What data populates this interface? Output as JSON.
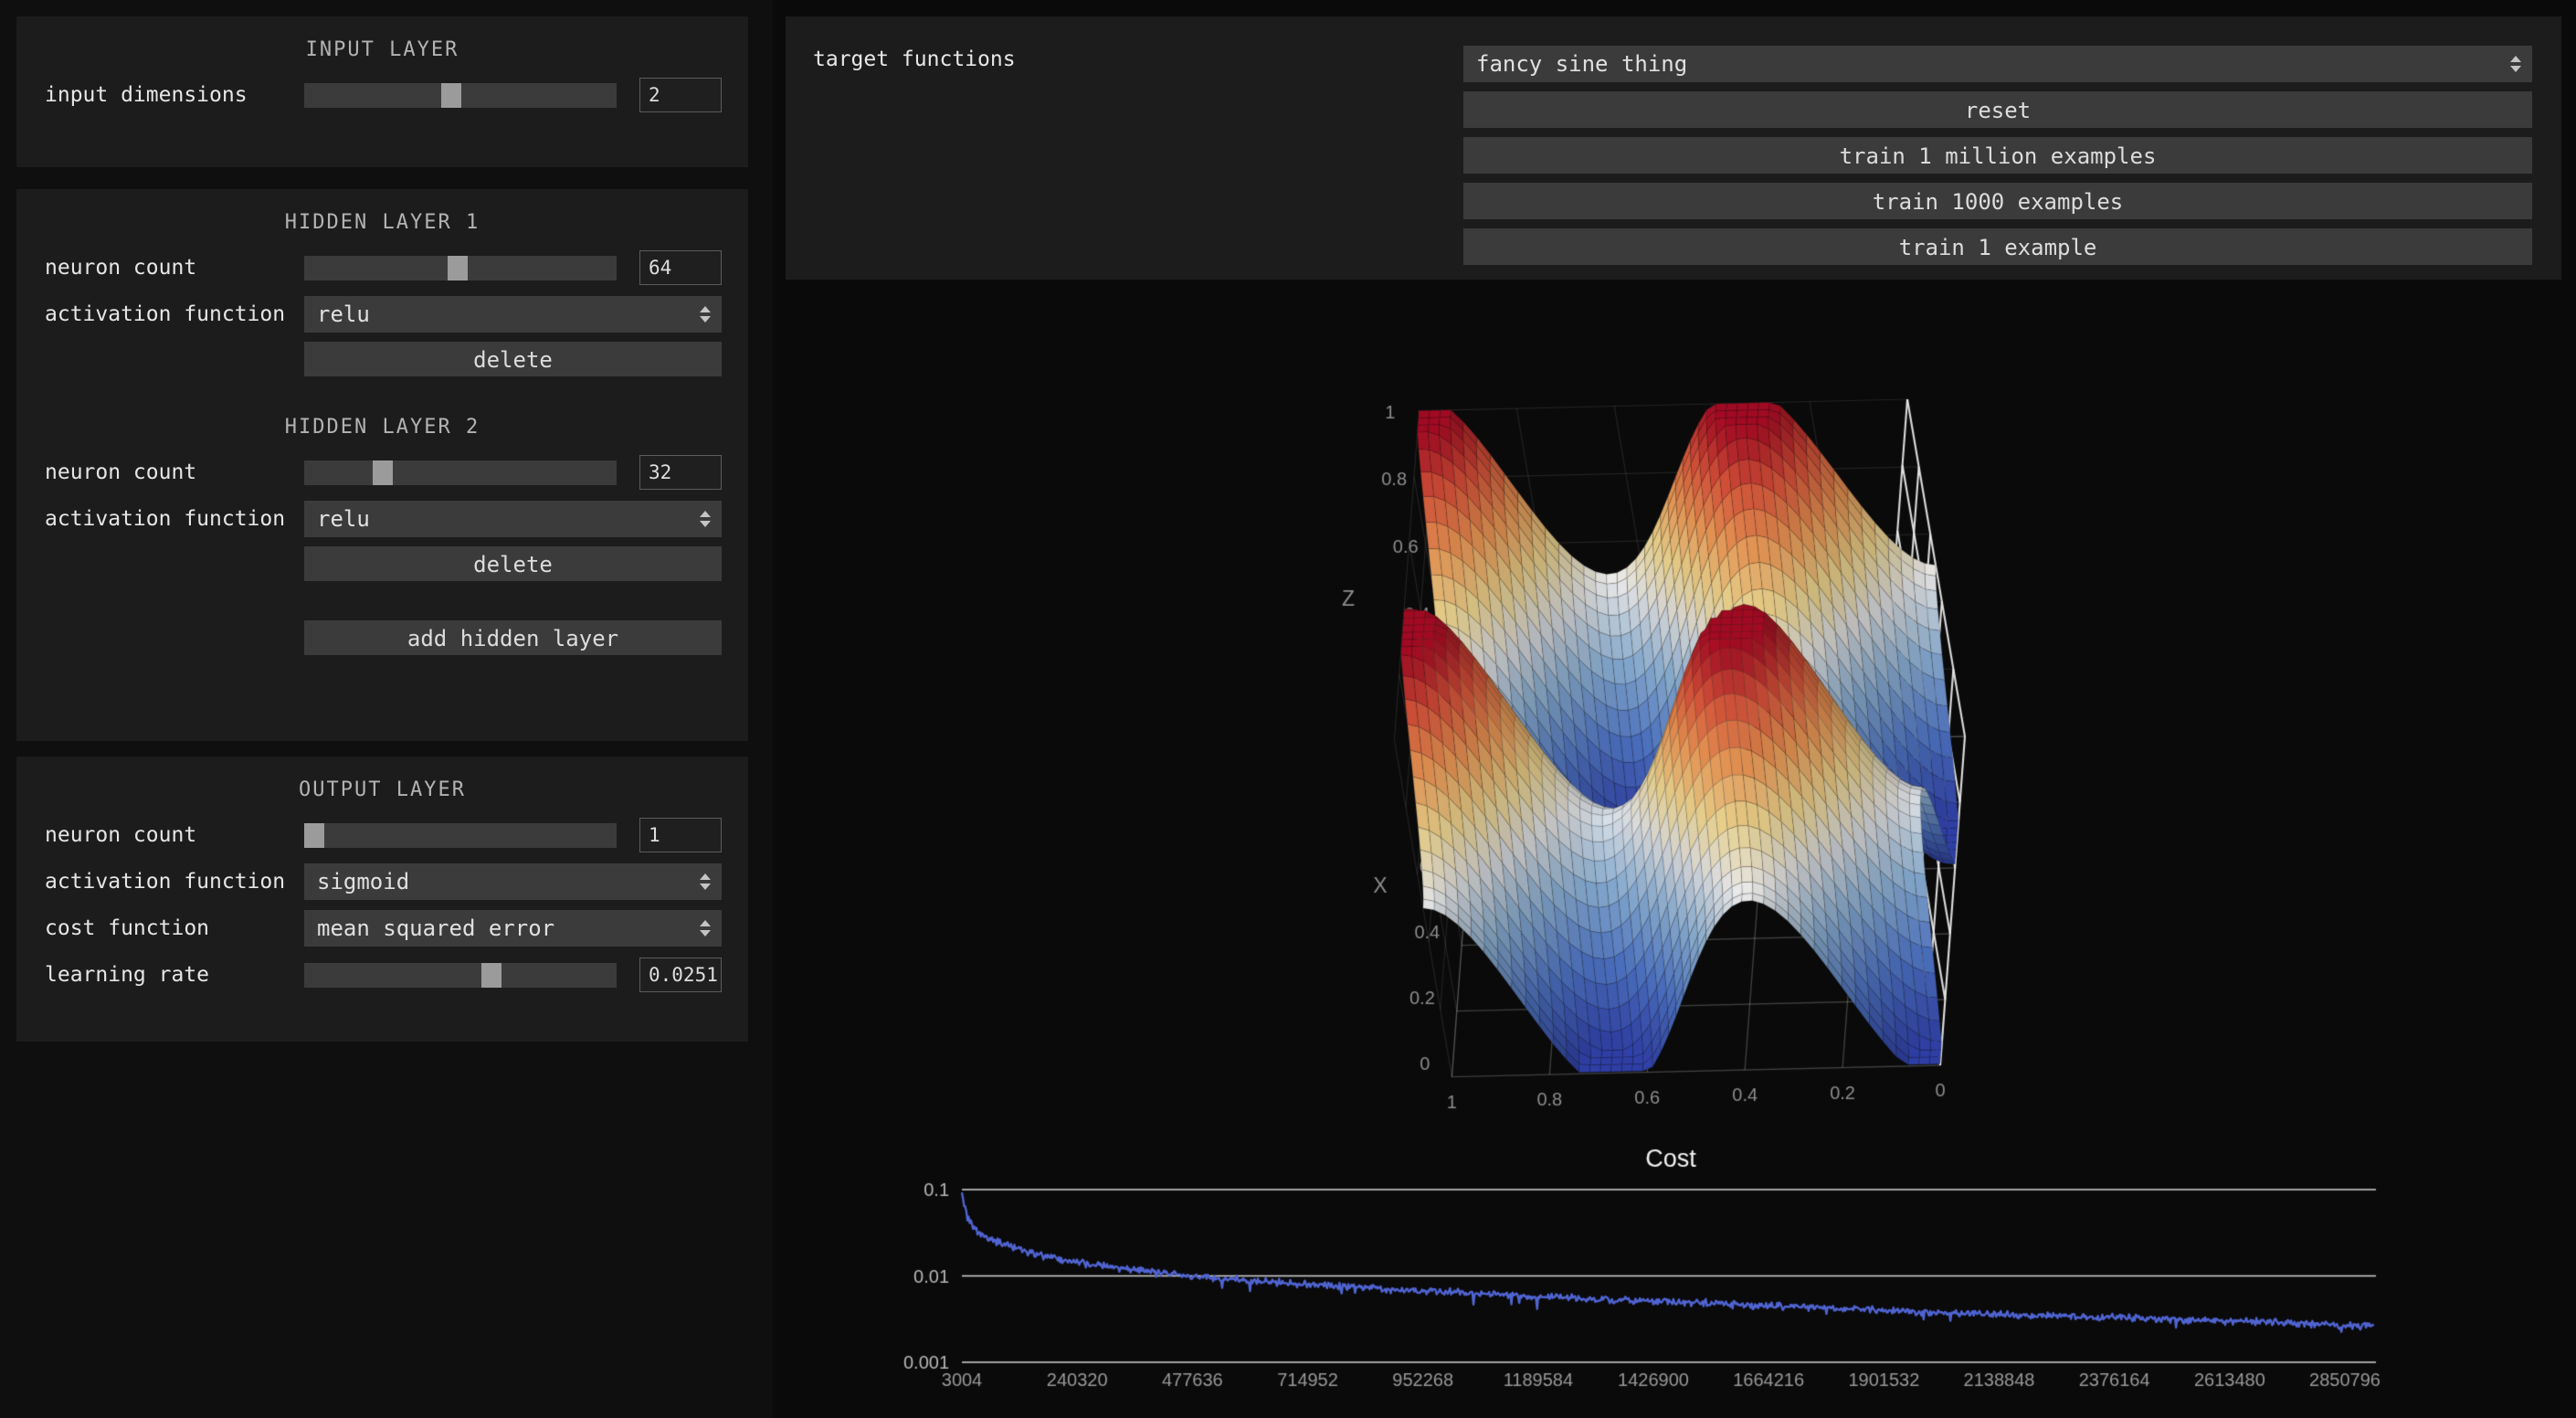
{
  "colors": {
    "page_bg": "#0f0f0f",
    "plot_bg": "#0a0a0a",
    "panel_bg": "#1c1c1c",
    "control_bg": "#3b3b3b",
    "slider_thumb": "#9b9b9b",
    "text": "#e6e6e6",
    "title_text": "#b3b3b3",
    "cost_line": "#5064d2"
  },
  "sidebar": {
    "input_panel": {
      "title": "INPUT LAYER",
      "row": {
        "label": "input dimensions",
        "value": "2",
        "percent": 47
      }
    },
    "hidden_panel": {
      "layer1": {
        "title": "HIDDEN LAYER 1",
        "neuron": {
          "label": "neuron count",
          "value": "64",
          "percent": 49
        },
        "activation": {
          "label": "activation function",
          "value": "relu"
        },
        "delete_label": "delete"
      },
      "layer2": {
        "title": "HIDDEN LAYER 2",
        "neuron": {
          "label": "neuron count",
          "value": "32",
          "percent": 25
        },
        "activation": {
          "label": "activation function",
          "value": "relu"
        },
        "delete_label": "delete"
      },
      "add_button_label": "add hidden layer"
    },
    "output_panel": {
      "title": "OUTPUT LAYER",
      "neuron": {
        "label": "neuron count",
        "value": "1",
        "percent": 2
      },
      "activation": {
        "label": "activation function",
        "value": "sigmoid"
      },
      "cost": {
        "label": "cost function",
        "value": "mean squared error"
      },
      "learning_rate": {
        "label": "learning rate",
        "value": "0.0251",
        "percent": 60
      }
    }
  },
  "control_bar": {
    "target_label": "target functions",
    "function_dropdown": {
      "value": "fancy sine thing"
    },
    "buttons": {
      "reset": "reset",
      "train_million": "train 1 million examples",
      "train_thousand": "train 1000 examples",
      "train_one": "train 1 example"
    }
  },
  "chart_data": [
    {
      "type": "surface",
      "description": "3D surface plot of the network output z = f(x,y) approximating the 'fancy sine thing' target function; red = high, white = middle, blue = low",
      "x_title": "X",
      "z_title": "Z",
      "x_range": [
        0,
        1
      ],
      "y_range": [
        0,
        1
      ],
      "z_range": [
        0,
        1
      ],
      "x_ticks": [
        "0",
        "0.2",
        "0.4",
        "0.6",
        "0.8"
      ],
      "y_ticks": [
        "1",
        "0.8",
        "0.6",
        "0.4",
        "0.2",
        "0"
      ],
      "z_ticks": [
        "1",
        "0.8",
        "0.6",
        "0.4",
        "0.2",
        "0"
      ],
      "grid": true,
      "mesh_n": 46,
      "function_params": {
        "cos_freq": 3,
        "cos_amp": 0.28,
        "pit_amp": 0.5,
        "pit_sigma2": 0.018,
        "wobble_amp": 0.02
      },
      "colorscale": [
        [
          0.0,
          "#2f3ea8"
        ],
        [
          0.18,
          "#5279cd"
        ],
        [
          0.35,
          "#92b8de"
        ],
        [
          0.5,
          "#ebebeb"
        ],
        [
          0.62,
          "#fae096"
        ],
        [
          0.75,
          "#f8a05a"
        ],
        [
          0.88,
          "#e1553c"
        ],
        [
          1.0,
          "#a50a23"
        ]
      ]
    },
    {
      "type": "line",
      "title": "Cost",
      "y_scale": "log",
      "y_ticks": [
        "0.1",
        "0.01",
        "0.001"
      ],
      "x_ticks": [
        "3004",
        "240320",
        "477636",
        "714952",
        "952268",
        "1189584",
        "1426900",
        "1664216",
        "1901532",
        "2138848",
        "2376164",
        "2613480",
        "2850796"
      ],
      "x_range": [
        3004,
        2912000
      ],
      "y_range": [
        0.001,
        0.1
      ],
      "legend": "none",
      "line_color": "#5064d2",
      "anchors": [
        [
          3004,
          0.1
        ],
        [
          9000,
          0.06
        ],
        [
          16000,
          0.045
        ],
        [
          30000,
          0.034
        ],
        [
          60000,
          0.027
        ],
        [
          100000,
          0.022
        ],
        [
          150000,
          0.018
        ],
        [
          240320,
          0.0142
        ],
        [
          360000,
          0.0118
        ],
        [
          477636,
          0.0098
        ],
        [
          600000,
          0.0088
        ],
        [
          714952,
          0.008
        ],
        [
          850000,
          0.0072
        ],
        [
          952268,
          0.0067
        ],
        [
          1100000,
          0.0061
        ],
        [
          1189584,
          0.0058
        ],
        [
          1300000,
          0.0054
        ],
        [
          1426900,
          0.0051
        ],
        [
          1550000,
          0.0048
        ],
        [
          1664216,
          0.0045
        ],
        [
          1800000,
          0.0042
        ],
        [
          1901532,
          0.004
        ],
        [
          2000000,
          0.0038
        ],
        [
          2138848,
          0.0036
        ],
        [
          2250000,
          0.0035
        ],
        [
          2376164,
          0.0033
        ],
        [
          2500000,
          0.0031
        ],
        [
          2613480,
          0.003
        ],
        [
          2700000,
          0.0029
        ],
        [
          2850796,
          0.0027
        ],
        [
          2912000,
          0.0026
        ]
      ]
    }
  ]
}
